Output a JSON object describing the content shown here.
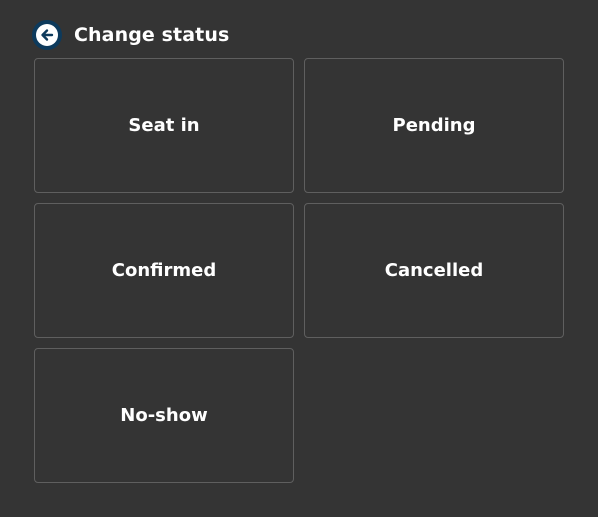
{
  "header": {
    "back_icon": "arrow-left-circle-icon",
    "title": "Change status"
  },
  "colors": {
    "background": "#343434",
    "tile_border": "#5f5f5f",
    "back_button_ring": "#0d3a5c",
    "text": "#ffffff"
  },
  "statuses": [
    {
      "label": "Seat in"
    },
    {
      "label": "Pending"
    },
    {
      "label": "Confirmed"
    },
    {
      "label": "Cancelled"
    },
    {
      "label": "No-show"
    }
  ]
}
